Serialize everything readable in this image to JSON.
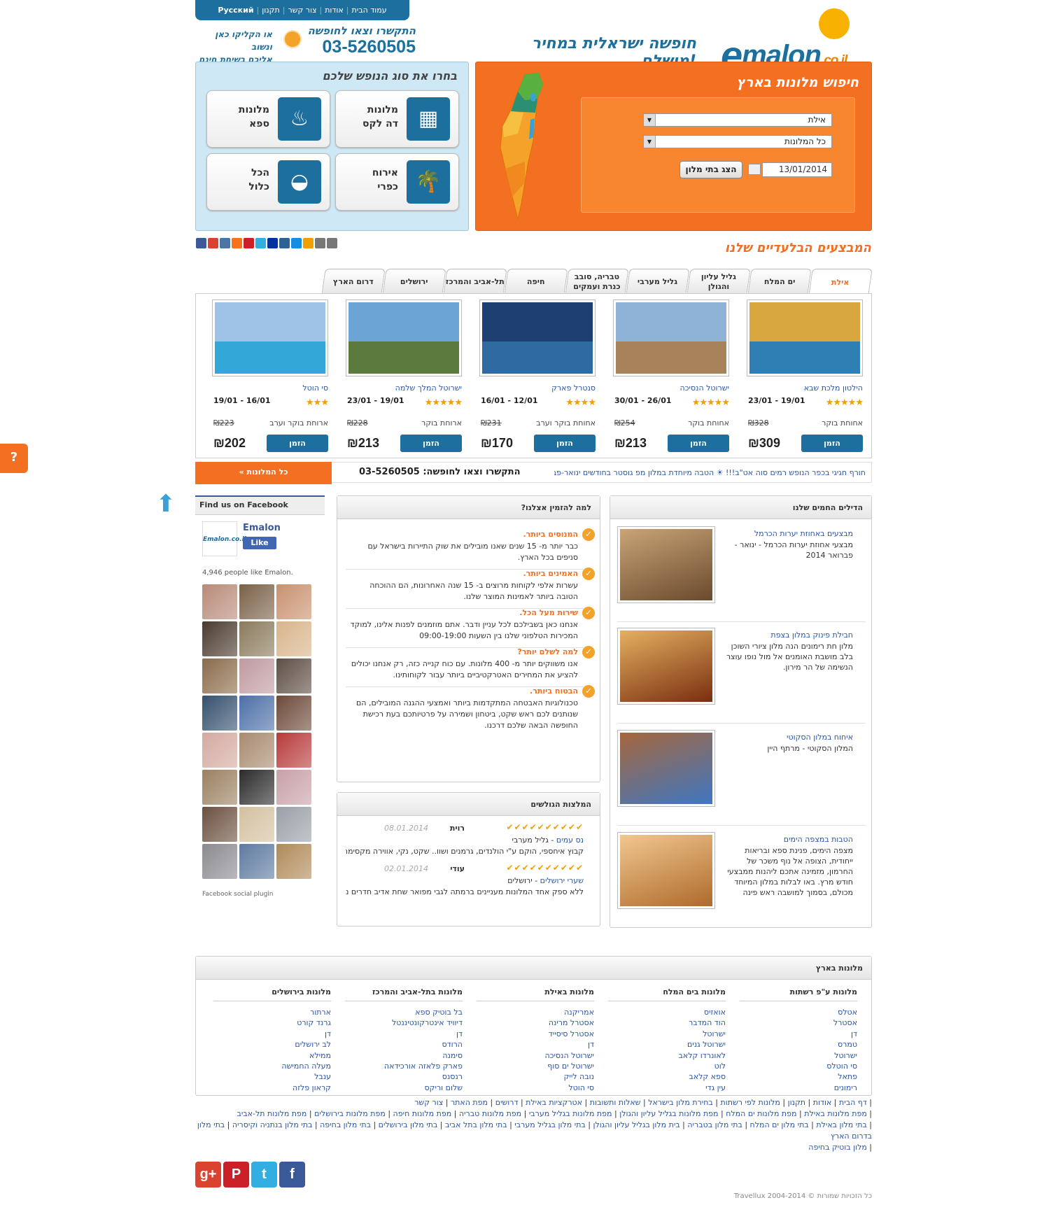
{
  "topnav": {
    "items": [
      "עמוד הבית",
      "אודות",
      "צור קשר",
      "תקנון",
      "Русский"
    ]
  },
  "header": {
    "call_label": "התקשרו וצאו לחופשה",
    "phone": "03-5260505",
    "click_line1": "או הקליקו כאן ונשוב",
    "click_line2": "אליכם בשיחת חינם",
    "slogan": "חופשה ישראלית במחיר מושלם!",
    "logo_e": "e",
    "logo_word": "malon",
    "logo_tld": ".co.il"
  },
  "search": {
    "title": "חיפוש מלונות בארץ",
    "city": "אילת",
    "hotel_filter": "כל המלונות",
    "date": "13/01/2014",
    "button": "הצג בתי מלון"
  },
  "types": {
    "title": "בחרו את סוג הנופש שלכם",
    "items": [
      {
        "l1": "מלונות",
        "l2": "דה לקס",
        "icon": "hotel-building-icon"
      },
      {
        "l1": "מלונות",
        "l2": "ספא",
        "icon": "spa-massage-icon"
      },
      {
        "l1": "אירוח",
        "l2": "כפרי",
        "icon": "palm-tree-icon"
      },
      {
        "l1": "הכל",
        "l2": "כלול",
        "icon": "food-tray-icon"
      }
    ]
  },
  "share_icons": [
    "facebook-icon",
    "google-plus-icon",
    "vk-icon",
    "odnoklassniki-icon",
    "pinterest-icon",
    "twitter-icon",
    "myspace-icon",
    "livejournal-icon",
    "mailru-icon",
    "settings-icon",
    "print-icon",
    "email-icon"
  ],
  "deals_title": "המבצעים הבלעדיים שלנו",
  "tabs": [
    "אילת",
    "ים המלח",
    "גליל עליון והגולן",
    "גליל מערבי",
    "טבריה, סובב כנרת ועמקים",
    "חיפה",
    "תל-אביב והמרכז",
    "ירושלים",
    "דרום הארץ"
  ],
  "hotels": [
    {
      "name": "הילטון מלכת שבא",
      "dates": "19/01 - 23/01",
      "stars": "★★★★★",
      "board": "אחוחת בוקר",
      "old": "328",
      "price": "309",
      "book": "הזמן",
      "colors": [
        "#d9a740",
        "#2f7fb5"
      ]
    },
    {
      "name": "ישרוטל הנסיכה",
      "dates": "26/01 - 30/01",
      "stars": "★★★★★",
      "board": "אחוחת בוקר",
      "old": "254",
      "price": "213",
      "book": "הזמן",
      "colors": [
        "#8eb3d6",
        "#a8825a"
      ]
    },
    {
      "name": "סנטרל פארק",
      "dates": "12/01 - 16/01",
      "stars": "★★★★",
      "board": "אחוחת בוקר וערב",
      "old": "231",
      "price": "170",
      "book": "הזמן",
      "colors": [
        "#1e3f72",
        "#2f6aa0"
      ]
    },
    {
      "name": "ישרוטל המלך שלמה",
      "dates": "19/01 - 23/01",
      "stars": "★★★★★",
      "board": "ארוחת בוקר",
      "old": "228",
      "price": "213",
      "book": "הזמן",
      "colors": [
        "#6da4d6",
        "#5c7a3e"
      ]
    },
    {
      "name": "סי הוטל",
      "dates": "16/01 - 19/01",
      "stars": "★★★",
      "board": "ארוחת בוקר וערב",
      "old": "223",
      "price": "202",
      "book": "הזמן",
      "colors": [
        "#9ec3e6",
        "#33a8d8"
      ]
    }
  ],
  "currency": "₪",
  "ticker": {
    "text": "חורף חגיגי בכפר הנופש רמים סוה אט\"ב!!! ☀ הטבה מיוחדת במלון מפ גוסטר בחודשים ינואר-פברואר",
    "phone_label": "התקשרו וצאו לחופשה: 03-5260505",
    "all_hotels": "כל המלונות  »"
  },
  "side_button": "?",
  "facebook": {
    "title": "Find us on Facebook",
    "page_name": "Emalon",
    "logo_text": "Emalon.co.il",
    "like": "Like",
    "count": "4,946 people like Emalon.",
    "plugin": "Facebook social plugin",
    "faces": [
      "#b88a78",
      "#7a6148",
      "#c9916f",
      "#4a3a2e",
      "#8a7a5c",
      "#d8b48a",
      "#8b6b4a",
      "#c09aa0",
      "#5e4e44",
      "#35506d",
      "#4c6fa8",
      "#6e4a3a",
      "#d4a9a0",
      "#a88a70",
      "#b83a3a",
      "#9a8060",
      "#2b2b2b",
      "#c8a0a8",
      "#6b5040",
      "#d4c0a0",
      "#9aa0a8",
      "#8a8a90",
      "#5e7aa0",
      "#b08a58"
    ]
  },
  "why": {
    "title": "למה להזמין אצלנו?",
    "items": [
      {
        "t": "המנוסים ביותר.",
        "d": "כבר יותר מ- 15 שנים שאנו מובילים את שוק התיירות בישראל עם סניפים בכל הארץ."
      },
      {
        "t": "האמינים ביותר.",
        "d": "עשרות אלפי לקוחות מרוצים ב- 15 שנה האחרונות, הם ההוכחה הטובה ביותר לאמינות המוצר שלנו."
      },
      {
        "t": "שירות מעל הכל.",
        "d": "אנחנו כאן בשבילכם לכל עניין ודבר. אתם מוזמנים לפנות אלינו, למוקד המכירות הטלפוני שלנו בין השעות 09:00-19:00"
      },
      {
        "t": "למה לשלם יותר?",
        "d": "אנו משווקים יותר מ- 400 מלונות. עם כוח קנייה כזה, רק אנחנו יכולים להציע את המחירים האטרקטיביים ביותר עבור לקוחותינו."
      },
      {
        "t": "הבטוח ביותר.",
        "d": "טכנולוגיות האבטחה המתקדמות ביותר ואמצעי ההגנה המובילים, הם שנותנים לכם ראש שקט, ביטחון ושמירה על פרטיותכם בעת רכישת החופשה הבאה שלכם דרכנו."
      }
    ]
  },
  "reviews": {
    "title": "המלצות הגולשים",
    "items": [
      {
        "stars": "✔✔✔✔✔✔✔✔✔✔",
        "name": "רוית",
        "date": "08.01.2014",
        "hotel": "נס עמים",
        "region": " - גליל מערבי",
        "text": "קבוץ איחספי, הוקם ע\"י הולנדים, גרמנים ושוו.. שקט, נקי, אווירה מקסימה, ..."
      },
      {
        "stars": "✔✔✔✔✔✔✔✔✔✔",
        "name": "עודי",
        "date": "02.01.2014",
        "hotel": "שערי ירושלים",
        "region": " - ירושלים",
        "text": "ללא ספק אחד המלונות מעניינים ברמתה לגבי מפואר שחת אדיב חדרים נוחי..."
      }
    ]
  },
  "hot": {
    "title": "הדילים החמים שלנו",
    "items": [
      {
        "t": "מבצעים באחוזת יערות הכרמל",
        "d": "מבצעי אחוזת יערות הכרמל - ינואר - פברואר 2014",
        "colors": [
          "#6a4a2e",
          "#c9a476"
        ]
      },
      {
        "t": "חבילת פינוק במלון בצפת",
        "d": "מלון חת רימונים הנה מלון ציורי השוכן בלב מושבת האומנים אל מול נופו עוצר הנשימה של הר מירון.",
        "colors": [
          "#7a2e10",
          "#e4b060"
        ]
      },
      {
        "t": "איחוח במלון הסקוטי",
        "d": "המלון הסקוטי - מרתף היין",
        "colors": [
          "#3f77c2",
          "#a5663c"
        ]
      },
      {
        "t": "הטבות במצפה הימים",
        "d": "מצפה הימים, פנינת ספא ובריאות ייחודית, הצופה אל נוף משכר של החרמון, מזמינה אתכם ליהנות ממבצעי חודש מרץ. באו לבלות במלון המיוחד מכולם, בסמוך למושבה ראש פינה",
        "colors": [
          "#b06a2c",
          "#f0c890"
        ]
      }
    ]
  },
  "country": {
    "title": "מלונות בארץ",
    "cols": [
      {
        "h": "מלונות ע\"פ רשתות",
        "links": [
          "אטלס",
          "אסטרל",
          "דן",
          "טמרס",
          "ישרוטל",
          "סי הוטלס",
          "פתאל",
          "רימונים"
        ]
      },
      {
        "h": "מלונות בים המלח",
        "links": [
          "אואזיס",
          "הוד המדבר",
          "ישרוטל",
          "ישרוטל גנים",
          "לאונרדו קלאב",
          "לוט",
          "ספא קלאב",
          "עין גדי"
        ]
      },
      {
        "h": "מלונות באילת",
        "links": [
          "אמריקנה",
          "אסטרל מרינה",
          "אסטרל סיסייד",
          "דן",
          "ישרוטל הנסיכה",
          "ישרוטל ים סוף",
          "נובה לייק",
          "סי הוטל"
        ]
      },
      {
        "h": "מלונות בתל-אביב והמרכז",
        "links": [
          "בל בוטיק ספא",
          "דיוויד אינטרקונטיננטל",
          "דן",
          "הרודס",
          "סימנה",
          "פארק פלאזה אורכידאה",
          "רנסנס",
          "שלום וריקס"
        ]
      },
      {
        "h": "מלונות בירושלים",
        "links": [
          "ארתור",
          "גרנד קורט",
          "דן",
          "לב ירושלים",
          "ממילא",
          "מעלה החמישה",
          "ענבל",
          "קראון פלזה"
        ]
      }
    ]
  },
  "footer": {
    "row1": [
      "דף הבית",
      "אודות",
      "תקנון",
      "מלונות לפי רשתות",
      "בחירת מלון בישראל",
      "שאלות ותשובות",
      "אטרקציות באילת",
      "דרושים",
      "מפת האתר",
      "צור קשר"
    ],
    "row2": [
      "מפת מלונות באילת",
      "מפת מלונות ים המלח",
      "מפת מלונות בגליל עליון והגולן",
      "מפת מלונות בגליל מערבי",
      "מפת מלונות טבריה",
      "מפת מלונות חיפה",
      "מפת מלונות בירושלים",
      "מפת מלונות תל-אביב"
    ],
    "row3": [
      "בתי מלון באילת",
      "בתי מלון ים המלח",
      "בתי מלון בטבריה",
      "בית מלון בגליל עליון והגולן",
      "בתי מלון בגליל מערבי",
      "בתי מלון בתל אביב",
      "בתי מלון בירושלים",
      "בתי מלון בחיפה",
      "בתי מלון בנתניה וקיסריה",
      "בתי מלון בדרום הארץ"
    ],
    "row4": [
      "מלון בוטיק בחיפה"
    ],
    "copyright": "כל הזכויות שמורות © Travellux 2004-2014"
  },
  "social_footer": [
    {
      "icon": "google-plus-icon",
      "glyph": "g+",
      "color": "#d9432f"
    },
    {
      "icon": "pinterest-icon",
      "glyph": "P",
      "color": "#cb2027"
    },
    {
      "icon": "twitter-icon",
      "glyph": "t",
      "color": "#33aee0"
    },
    {
      "icon": "facebook-icon",
      "glyph": "f",
      "color": "#3b5998"
    }
  ]
}
